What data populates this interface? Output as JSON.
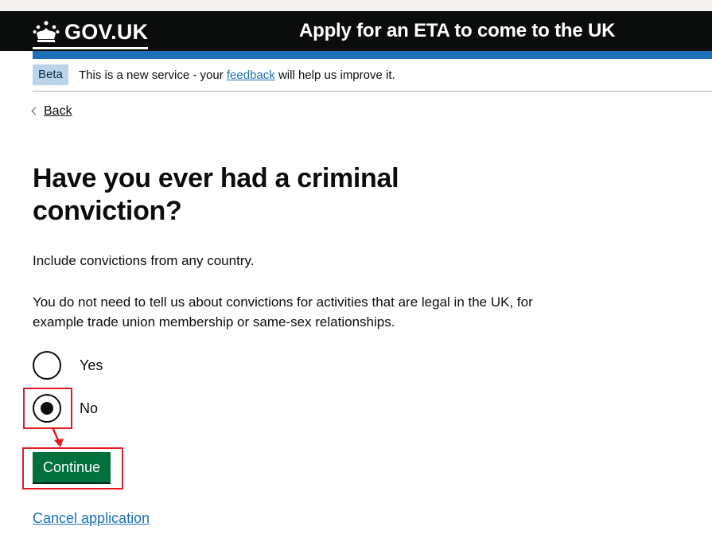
{
  "header": {
    "logo_text": "GOV.UK",
    "logo_icon": "crown-icon",
    "service_name": "Apply for an ETA to come to the UK"
  },
  "phase_banner": {
    "tag": "Beta",
    "text_before": "This is a new service - your ",
    "link": "feedback",
    "text_after": " will help us improve it."
  },
  "back_link": "Back",
  "question": {
    "title": "Have you ever had a criminal conviction?",
    "hint_1": "Include convictions from any country.",
    "hint_2": "You do not need to tell us about convictions for activities that are legal in the UK, for example trade union membership or same-sex relationships.",
    "options": [
      {
        "label": "Yes",
        "selected": false
      },
      {
        "label": "No",
        "selected": true
      }
    ]
  },
  "actions": {
    "continue_label": "Continue",
    "cancel_label": "Cancel application"
  },
  "colors": {
    "header_bg": "#0b0c0c",
    "accent_blue": "#1d70b8",
    "button_green": "#00703c",
    "highlight_red": "#e31b23",
    "tag_bg": "#bbd4ea"
  }
}
